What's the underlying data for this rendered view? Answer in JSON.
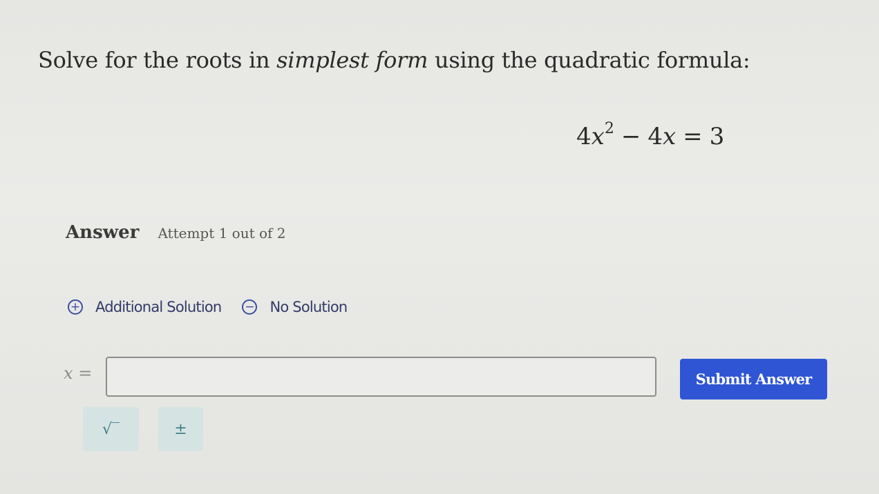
{
  "question": {
    "prefix": "Solve for the roots in ",
    "emphasis": "simplest form",
    "suffix": " using the quadratic formula:"
  },
  "equation": {
    "coef1": "4",
    "var1": "x",
    "exponent": "2",
    "operator": "−",
    "coef2": "4",
    "var2": "x",
    "equals": "=",
    "rhs": "3"
  },
  "answer": {
    "label": "Answer",
    "attempt": "Attempt 1 out of 2"
  },
  "options": {
    "additional_solution": "Additional Solution",
    "no_solution": "No Solution",
    "add_icon": "plus-circle-icon",
    "no_icon": "minus-circle-icon"
  },
  "input": {
    "variable": "x",
    "equals": "=",
    "value": "",
    "placeholder": ""
  },
  "submit_label": "Submit Answer",
  "tools": {
    "sqrt": "√‾",
    "plus_minus": "±"
  },
  "colors": {
    "primary": "#2f55d4",
    "option_text": "#333a66",
    "tool_bg": "#d5e4e3",
    "tool_text": "#3f7f88"
  }
}
